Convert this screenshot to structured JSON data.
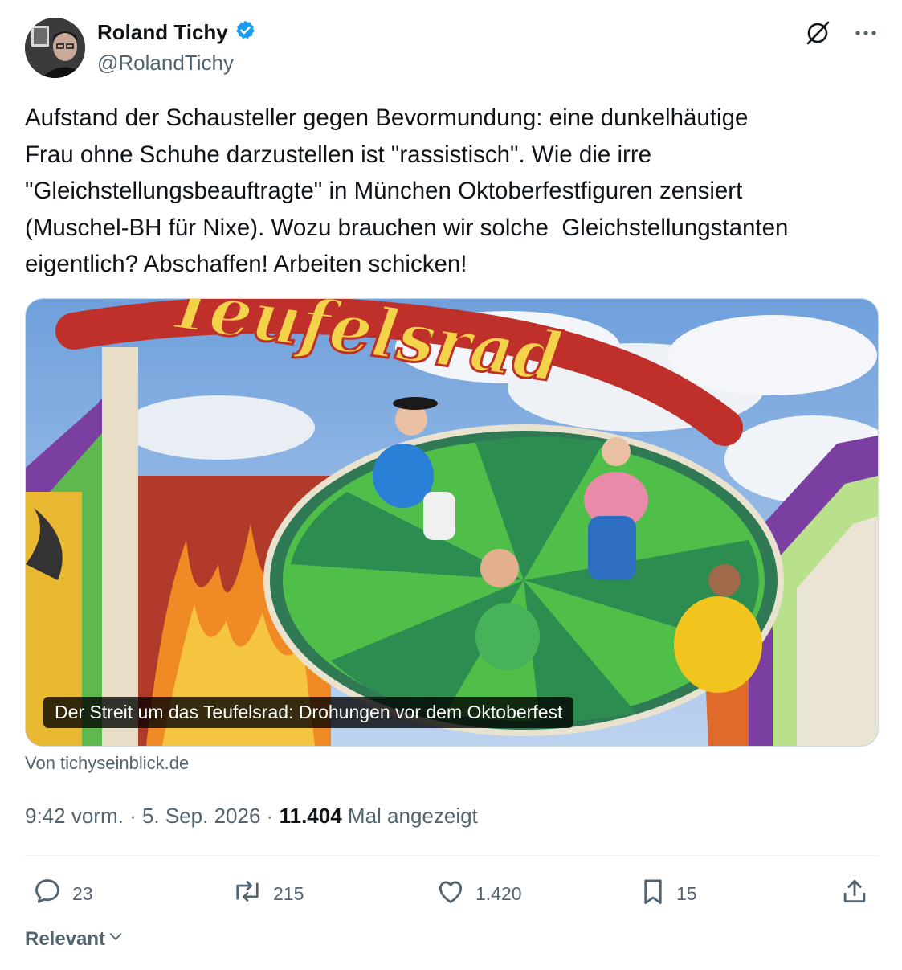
{
  "author": {
    "name": "Roland Tichy",
    "handle": "@RolandTichy",
    "verified": true,
    "verified_color": "#1d9bf0"
  },
  "header_icons": [
    "grok-icon",
    "more-icon"
  ],
  "tweet": {
    "text": "Aufstand der Schausteller gegen Bevormundung: eine dunkelhäutige\nFrau ohne Schuhe darzustellen ist \"rassistisch\". Wie die irre\n\"Gleichstellungsbeauftragte\" in München Oktoberfestfiguren zensiert\n(Muschel-BH für Nixe). Wozu brauchen wir solche  Gleichstellungstanten\neigentlich? Abschaffen! Arbeiten schicken!"
  },
  "link_card": {
    "image_sign_text": "Teufelsrad",
    "caption": "Der Streit um das Teufelsrad: Drohungen vor dem Oktoberfest",
    "source": "Von tichyseinblick.de"
  },
  "meta": {
    "time": "9:42 vorm.",
    "separator": "·",
    "date": "5. Sep. 2026",
    "views_count": "11.404",
    "views_label": "Mal angezeigt"
  },
  "actions": {
    "replies": "23",
    "reposts": "215",
    "likes": "1.420",
    "bookmarks": "15"
  },
  "sort": {
    "label": "Relevant"
  },
  "colors": {
    "text": "#0f1419",
    "secondary": "#536471",
    "border": "#cfd9de"
  }
}
